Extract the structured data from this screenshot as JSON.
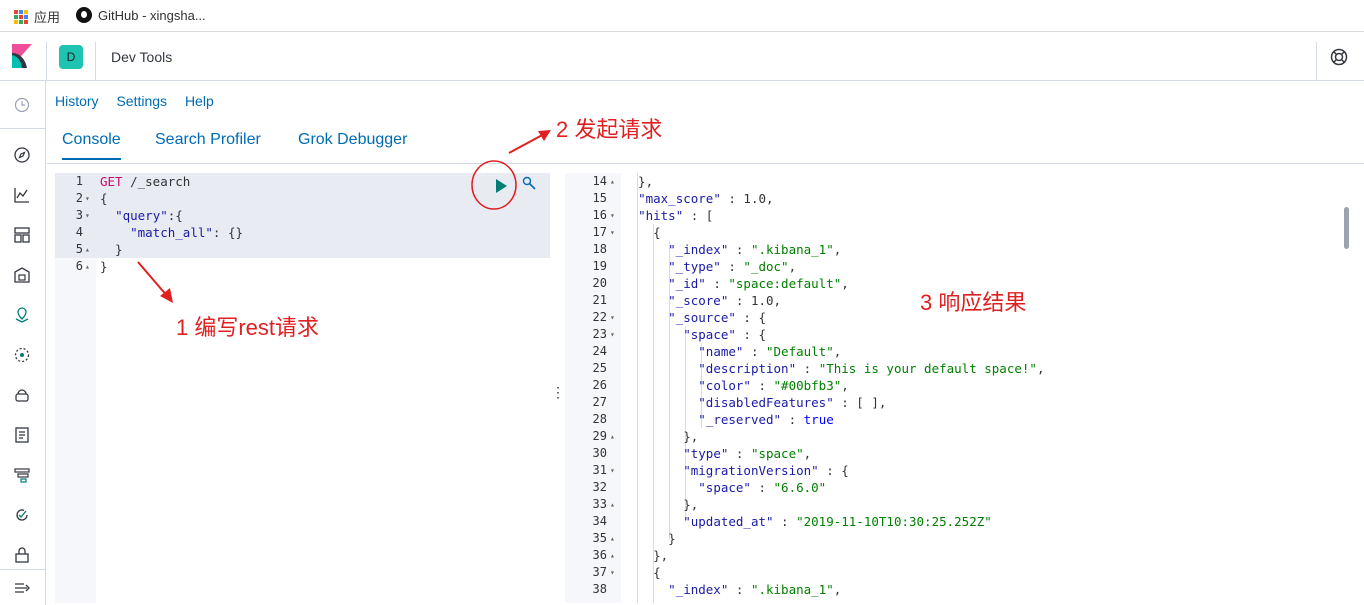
{
  "bookmarks": [
    {
      "label": "应用",
      "icon": "apps-grid-icon"
    },
    {
      "label": "GitHub - xingsha...",
      "icon": "github-icon"
    }
  ],
  "header": {
    "space_initial": "D",
    "app_title": "Dev Tools"
  },
  "topnav": [
    "History",
    "Settings",
    "Help"
  ],
  "tabs": [
    {
      "label": "Console",
      "active": true
    },
    {
      "label": "Search Profiler",
      "active": false
    },
    {
      "label": "Grok Debugger",
      "active": false
    }
  ],
  "editor": {
    "lines": [
      {
        "n": "1",
        "fold": "",
        "text": "GET /_search"
      },
      {
        "n": "2",
        "fold": "▾",
        "text": "{"
      },
      {
        "n": "3",
        "fold": "▾",
        "text": "  \"query\":{"
      },
      {
        "n": "4",
        "fold": "",
        "text": "    \"match_all\": {}"
      },
      {
        "n": "5",
        "fold": "▴",
        "text": "  }"
      },
      {
        "n": "6",
        "fold": "▴",
        "text": "}"
      }
    ]
  },
  "output": {
    "lines": [
      {
        "n": "14",
        "fold": "▴",
        "text": "  },"
      },
      {
        "n": "15",
        "fold": "",
        "text": "  \"max_score\" : 1.0,"
      },
      {
        "n": "16",
        "fold": "▾",
        "text": "  \"hits\" : ["
      },
      {
        "n": "17",
        "fold": "▾",
        "text": "    {"
      },
      {
        "n": "18",
        "fold": "",
        "text": "      \"_index\" : \".kibana_1\","
      },
      {
        "n": "19",
        "fold": "",
        "text": "      \"_type\" : \"_doc\","
      },
      {
        "n": "20",
        "fold": "",
        "text": "      \"_id\" : \"space:default\","
      },
      {
        "n": "21",
        "fold": "",
        "text": "      \"_score\" : 1.0,"
      },
      {
        "n": "22",
        "fold": "▾",
        "text": "      \"_source\" : {"
      },
      {
        "n": "23",
        "fold": "▾",
        "text": "        \"space\" : {"
      },
      {
        "n": "24",
        "fold": "",
        "text": "          \"name\" : \"Default\","
      },
      {
        "n": "25",
        "fold": "",
        "text": "          \"description\" : \"This is your default space!\","
      },
      {
        "n": "26",
        "fold": "",
        "text": "          \"color\" : \"#00bfb3\","
      },
      {
        "n": "27",
        "fold": "",
        "text": "          \"disabledFeatures\" : [ ],"
      },
      {
        "n": "28",
        "fold": "",
        "text": "          \"_reserved\" : true"
      },
      {
        "n": "29",
        "fold": "▴",
        "text": "        },"
      },
      {
        "n": "30",
        "fold": "",
        "text": "        \"type\" : \"space\","
      },
      {
        "n": "31",
        "fold": "▾",
        "text": "        \"migrationVersion\" : {"
      },
      {
        "n": "32",
        "fold": "",
        "text": "          \"space\" : \"6.6.0\""
      },
      {
        "n": "33",
        "fold": "▴",
        "text": "        },"
      },
      {
        "n": "34",
        "fold": "",
        "text": "        \"updated_at\" : \"2019-11-10T10:30:25.252Z\""
      },
      {
        "n": "35",
        "fold": "▴",
        "text": "      }"
      },
      {
        "n": "36",
        "fold": "▴",
        "text": "    },"
      },
      {
        "n": "37",
        "fold": "▾",
        "text": "    {"
      },
      {
        "n": "38",
        "fold": "",
        "text": "      \"_index\" : \".kibana_1\","
      }
    ]
  },
  "annotations": {
    "compose": "1 编写rest请求",
    "send": "2 发起请求",
    "response": "3 响应结果"
  },
  "colors": {
    "accent": "#006bb4",
    "run": "#017d73",
    "annotation": "#e02020",
    "space_avatar": "#1ec4b0"
  },
  "nav_icons": [
    "clock-icon",
    "compass-icon",
    "visualize-icon",
    "dashboard-icon",
    "canvas-icon",
    "maps-icon",
    "ml-icon",
    "infra-icon",
    "logs-icon",
    "apm-icon",
    "uptime-icon",
    "security-icon",
    "collapse-icon"
  ]
}
